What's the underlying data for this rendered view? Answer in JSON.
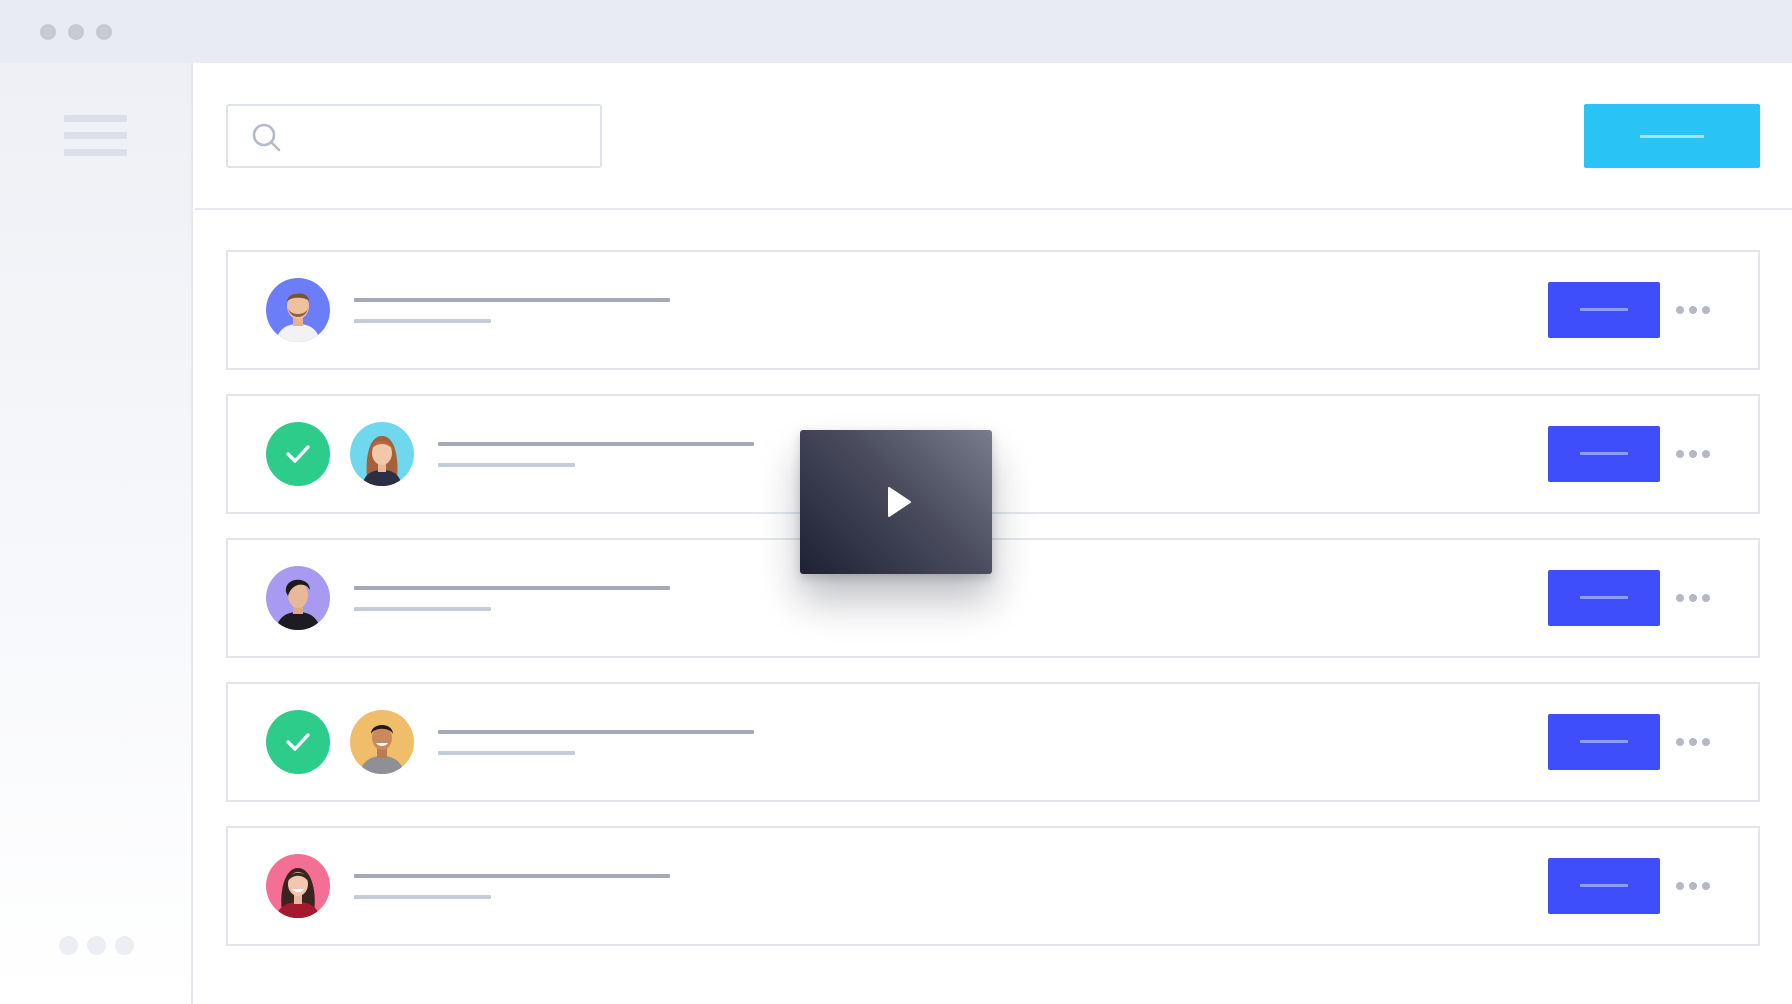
{
  "window": {
    "title_dots": [
      "close",
      "minimize",
      "maximize"
    ]
  },
  "sidebar": {
    "menu_icon": "hamburger-icon",
    "more_icon": "ellipsis-icon"
  },
  "header": {
    "search": {
      "value": "",
      "placeholder": "",
      "icon": "search-icon"
    },
    "primary_button_label": ""
  },
  "list": {
    "rows": [
      {
        "checked": false,
        "avatar_bg": "#6c7df8",
        "avatar_icon": "user-avatar-man-beard",
        "title": "",
        "subtitle": "",
        "action_label": ""
      },
      {
        "checked": true,
        "avatar_bg": "#6fd8ef",
        "avatar_icon": "user-avatar-woman-redhead",
        "title": "",
        "subtitle": "",
        "action_label": ""
      },
      {
        "checked": false,
        "avatar_bg": "#a79af0",
        "avatar_icon": "user-avatar-man-dark-hair",
        "title": "",
        "subtitle": "",
        "action_label": ""
      },
      {
        "checked": true,
        "avatar_bg": "#f0bd6a",
        "avatar_icon": "user-avatar-man-smiling",
        "title": "",
        "subtitle": "",
        "action_label": ""
      },
      {
        "checked": false,
        "avatar_bg": "#f46f93",
        "avatar_icon": "user-avatar-woman-dark-hair",
        "title": "",
        "subtitle": "",
        "action_label": ""
      }
    ]
  },
  "video_overlay": {
    "icon": "play-icon"
  },
  "colors": {
    "titlebar": "#e9ebf2",
    "cta": "#29c3f5",
    "action": "#3d4efa",
    "check": "#2ecc8a",
    "line_primary": "#a3aabb",
    "line_secondary": "#c6cbd6"
  }
}
